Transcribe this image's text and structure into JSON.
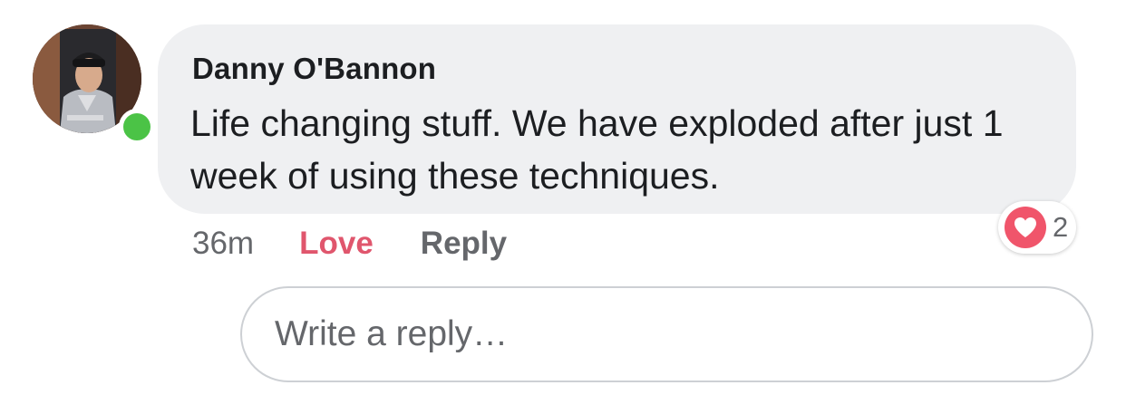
{
  "comment": {
    "author": "Danny O'Bannon",
    "text": "Life changing stuff. We have exploded after just 1 week of using these techniques.",
    "timestamp": "36m",
    "online": true
  },
  "actions": {
    "love_label": "Love",
    "reply_label": "Reply"
  },
  "reactions": {
    "icon": "heart-icon",
    "count": "2"
  },
  "reply_box": {
    "placeholder": "Write a reply…",
    "value": ""
  },
  "colors": {
    "bubble": "#eff0f2",
    "love": "#e0566d",
    "heart": "#f0556b",
    "online": "#4bc346",
    "muted": "#65676b",
    "text": "#1c1e21"
  }
}
